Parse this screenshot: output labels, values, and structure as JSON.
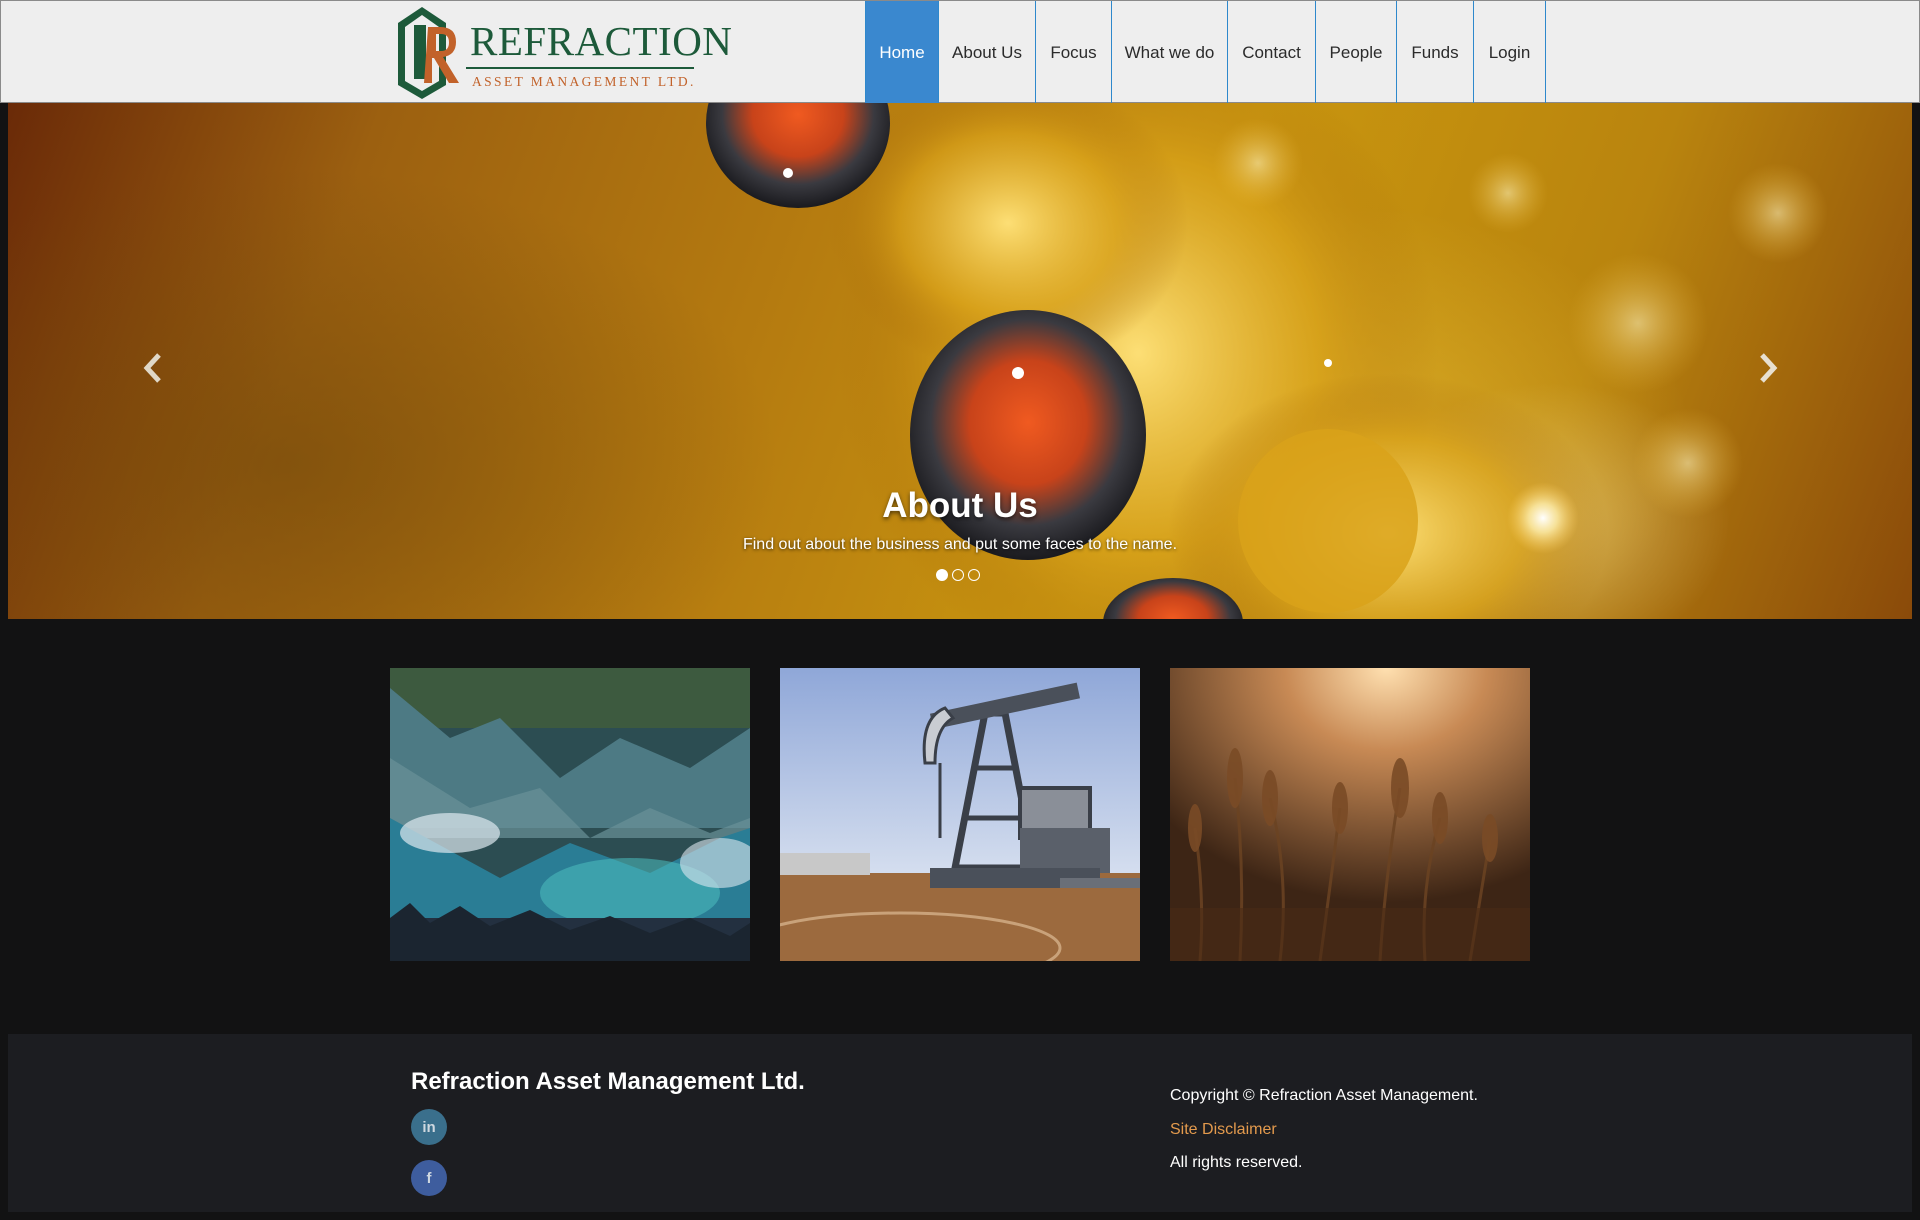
{
  "header": {
    "logo": {
      "name": "REFRACTION",
      "subtitle": "ASSET MANAGEMENT LTD.",
      "colors": {
        "green": "#1d5a3a",
        "orange": "#c2622a"
      }
    },
    "nav": [
      {
        "label": "Home",
        "active": true
      },
      {
        "label": "About Us"
      },
      {
        "label": "Focus"
      },
      {
        "label": "What we do"
      },
      {
        "label": "Contact"
      },
      {
        "label": "People"
      },
      {
        "label": "Funds"
      },
      {
        "label": "Login"
      }
    ],
    "accent_color": "#3a88cf"
  },
  "hero": {
    "title": "About Us",
    "caption": "Find out about the business and put some faces to the name.",
    "slide_count": 3,
    "active_slide": 1,
    "prev_icon": "chevron-left-icon",
    "next_icon": "chevron-right-icon"
  },
  "thumbnails": [
    {
      "subject": "mountain lake reflection"
    },
    {
      "subject": "oil pumpjack"
    },
    {
      "subject": "wheat field at sunset"
    }
  ],
  "footer": {
    "company": "Refraction Asset Management Ltd.",
    "social": [
      {
        "icon": "linkedin-icon",
        "glyph": "in"
      },
      {
        "icon": "facebook-icon",
        "glyph": "f"
      }
    ],
    "copyright": "Copyright © Refraction Asset Management.",
    "disclaimer": "Site Disclaimer",
    "rights": "All rights reserved.",
    "link_color": "#e39a4d"
  }
}
